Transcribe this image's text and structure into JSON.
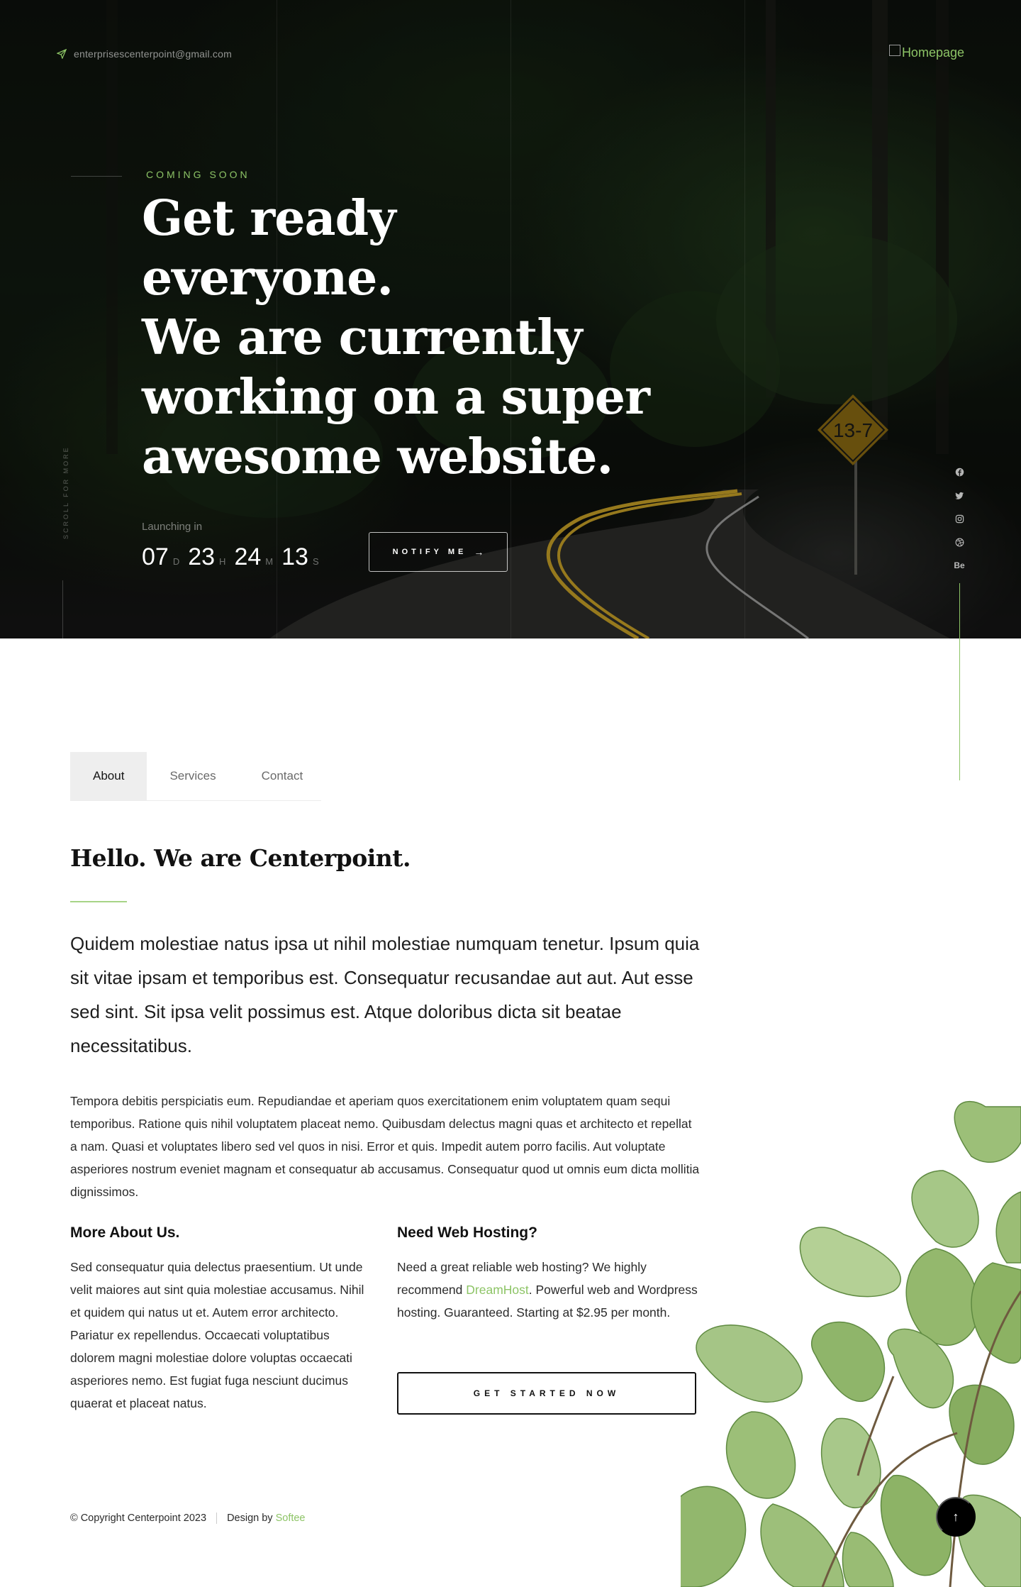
{
  "header": {
    "email": "enterprisescenterpoint@gmail.com",
    "logo_alt": "Homepage"
  },
  "hero": {
    "eyebrow": "COMING SOON",
    "headline": [
      "Get ready everyone.",
      "We are currently",
      "working on a super",
      "awesome website."
    ],
    "scroll_label": "SCROLL FOR MORE",
    "launch_label": "Launching in",
    "countdown": [
      {
        "value": "07",
        "unit": "D"
      },
      {
        "value": "23",
        "unit": "H"
      },
      {
        "value": "24",
        "unit": "M"
      },
      {
        "value": "13",
        "unit": "S"
      }
    ],
    "notify_label": "NOTIFY ME",
    "notify_arrow": "→",
    "social": [
      "facebook-icon",
      "twitter-icon",
      "instagram-icon",
      "dribbble-icon",
      "behance-icon"
    ],
    "behance_label": "Be"
  },
  "tabs": {
    "items": [
      "About",
      "Services",
      "Contact"
    ],
    "active": "About"
  },
  "about": {
    "title": "Hello. We are Centerpoint.",
    "lead": "Quidem molestiae natus ipsa ut nihil molestiae numquam tenetur. Ipsum quia sit vitae ipsam et temporibus est. Consequatur recusandae aut aut. Aut esse sed sint. Sit ipsa velit possimus est. Atque doloribus dicta sit beatae necessitatibus.",
    "body": "Tempora debitis perspiciatis eum. Repudiandae et aperiam quos exercitationem enim voluptatem quam sequi temporibus. Ratione quis nihil voluptatem placeat nemo. Quibusdam delectus magni quas et architecto et repellat a nam. Quasi et voluptates libero sed vel quos in nisi. Error et quis. Impedit autem porro facilis. Aut voluptate asperiores nostrum eveniet magnam et consequatur ab accusamus. Consequatur quod ut omnis eum dicta mollitia dignissimos.",
    "more": {
      "heading": "More About Us.",
      "text": "Sed consequatur quia delectus praesentium. Ut unde velit maiores aut sint quia molestiae accusamus. Nihil et quidem qui natus ut et. Autem error architecto. Pariatur ex repellendus. Occaecati voluptatibus dolorem magni molestiae dolore voluptas occaecati asperiores nemo. Est fugiat fuga nesciunt ducimus quaerat et placeat natus."
    },
    "hosting": {
      "heading": "Need Web Hosting?",
      "text_before": "Need a great reliable web hosting? We highly recommend ",
      "link": "DreamHost",
      "text_after": ". Powerful web and Wordpress hosting. Guaranteed. Starting at $2.95 per month.",
      "cta": "GET STARTED NOW"
    }
  },
  "footer": {
    "copyright": "© Copyright Centerpoint 2023",
    "design_prefix": "Design by ",
    "design_link": "Softee"
  },
  "to_top": "↑",
  "colors": {
    "accent": "#8dc466",
    "hero_bg": "#0d110c",
    "text": "#151515"
  }
}
